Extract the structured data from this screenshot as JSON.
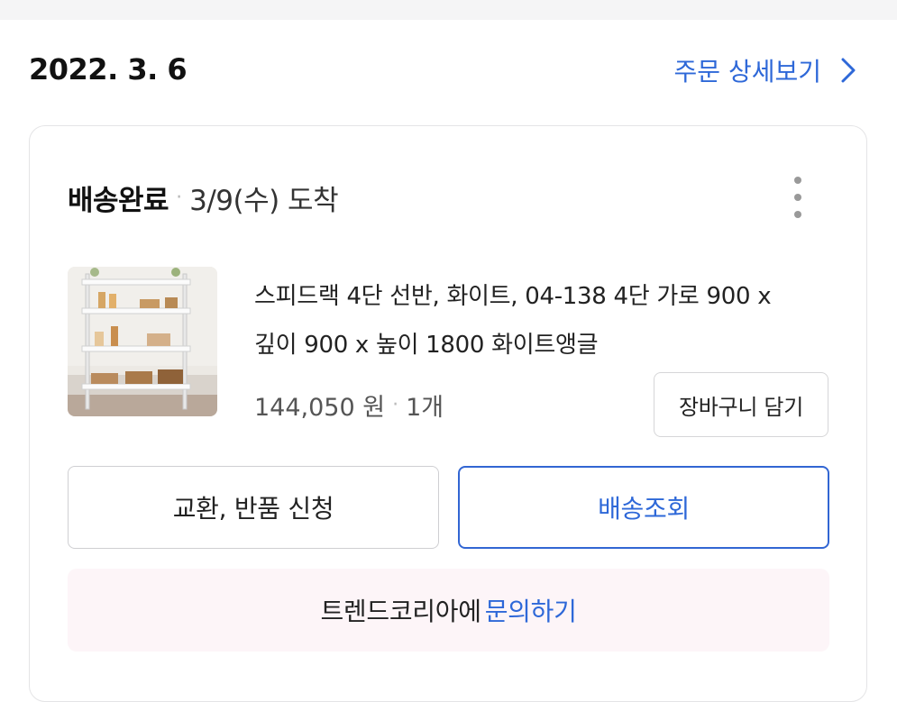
{
  "order": {
    "date": "2022. 3. 6",
    "detail_link": "주문 상세보기"
  },
  "shipment": {
    "status": "배송완료",
    "separator": "·",
    "arrival": "3/9(수) 도착"
  },
  "product": {
    "name_line1": "스피드랙 4단 선반, 화이트, 04-138 4단 가로 900 x",
    "name_line2": "깊이 900 x 높이 1800 화이트앵글",
    "price": "144,050 원",
    "separator": "·",
    "quantity": "1개",
    "cart_button": "장바구니 담기",
    "image_alt": "4-tier white shelf product photo"
  },
  "actions": {
    "exchange_return": "교환, 반품 신청",
    "track_delivery": "배송조회"
  },
  "inquiry": {
    "seller": "트렌드코리아에",
    "link": "문의하기"
  },
  "colors": {
    "accent": "#2e68d8",
    "inquiry_bg": "#fdf5f8",
    "top_strip": "#f5f5f6"
  }
}
